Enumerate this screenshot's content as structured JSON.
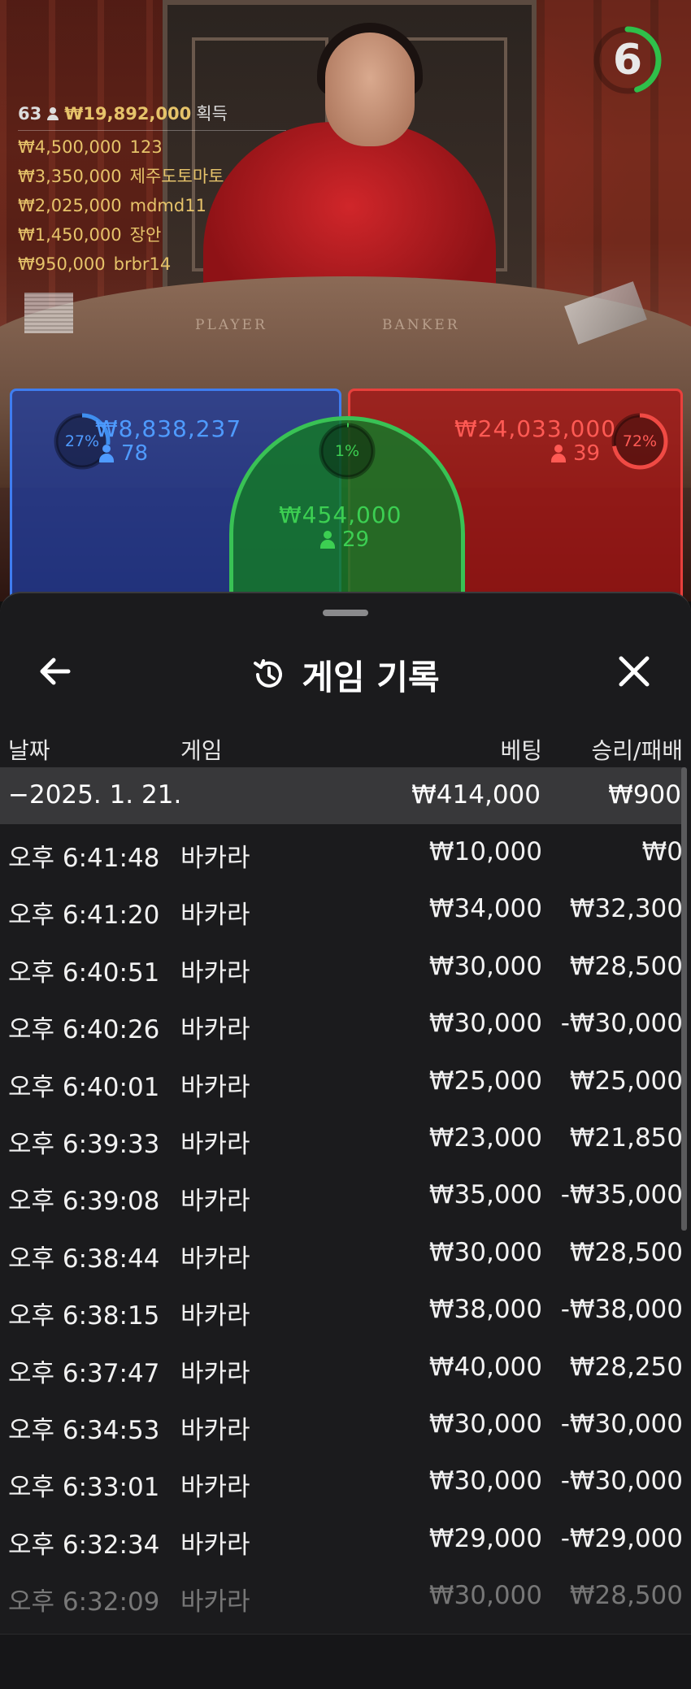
{
  "video": {
    "felt_player_label": "PLAYER",
    "felt_banker_label": "BANKER"
  },
  "countdown": {
    "value": "6",
    "progress": 0.45,
    "color": "#2fbf4a"
  },
  "winners": {
    "count": "63",
    "total": "₩19,892,000",
    "total_suffix": "획득",
    "list": [
      {
        "amount": "₩4,500,000",
        "name": "123"
      },
      {
        "amount": "₩3,350,000",
        "name": "제주도토마토"
      },
      {
        "amount": "₩2,025,000",
        "name": "mdmd11"
      },
      {
        "amount": "₩1,450,000",
        "name": "장안"
      },
      {
        "amount": "₩950,000",
        "name": "brbr14"
      }
    ]
  },
  "bets": {
    "player": {
      "percent_label": "27%",
      "percent": 27,
      "amount": "₩8,838,237",
      "players": "78",
      "color": "#3f8ff0"
    },
    "tie": {
      "percent_label": "1%",
      "percent": 1,
      "amount": "₩454,000",
      "players": "29",
      "color": "#3ccf52"
    },
    "banker": {
      "percent_label": "72%",
      "percent": 72,
      "amount": "₩24,033,000",
      "players": "39",
      "color": "#f04a44"
    }
  },
  "sheet": {
    "title": "게임 기록",
    "back_icon": "arrow-left-icon",
    "history_icon": "history-icon",
    "close_icon": "close-icon",
    "columns": {
      "date": "날짜",
      "game": "게임",
      "bet": "베팅",
      "result": "승리/패배"
    },
    "day": {
      "date": "−2025. 1. 21.",
      "bet": "₩414,000",
      "result": "₩900"
    },
    "rows": [
      {
        "time": "오후 6:41:48",
        "game": "바카라",
        "bet": "₩10,000",
        "result": "₩0"
      },
      {
        "time": "오후 6:41:20",
        "game": "바카라",
        "bet": "₩34,000",
        "result": "₩32,300"
      },
      {
        "time": "오후 6:40:51",
        "game": "바카라",
        "bet": "₩30,000",
        "result": "₩28,500"
      },
      {
        "time": "오후 6:40:26",
        "game": "바카라",
        "bet": "₩30,000",
        "result": "-₩30,000"
      },
      {
        "time": "오후 6:40:01",
        "game": "바카라",
        "bet": "₩25,000",
        "result": "₩25,000"
      },
      {
        "time": "오후 6:39:33",
        "game": "바카라",
        "bet": "₩23,000",
        "result": "₩21,850"
      },
      {
        "time": "오후 6:39:08",
        "game": "바카라",
        "bet": "₩35,000",
        "result": "-₩35,000"
      },
      {
        "time": "오후 6:38:44",
        "game": "바카라",
        "bet": "₩30,000",
        "result": "₩28,500"
      },
      {
        "time": "오후 6:38:15",
        "game": "바카라",
        "bet": "₩38,000",
        "result": "-₩38,000"
      },
      {
        "time": "오후 6:37:47",
        "game": "바카라",
        "bet": "₩40,000",
        "result": "₩28,250"
      },
      {
        "time": "오후 6:34:53",
        "game": "바카라",
        "bet": "₩30,000",
        "result": "-₩30,000"
      },
      {
        "time": "오후 6:33:01",
        "game": "바카라",
        "bet": "₩30,000",
        "result": "-₩30,000"
      },
      {
        "time": "오후 6:32:34",
        "game": "바카라",
        "bet": "₩29,000",
        "result": "-₩29,000"
      },
      {
        "time": "오후 6:32:09",
        "game": "바카라",
        "bet": "₩30,000",
        "result": "₩28,500"
      }
    ]
  }
}
